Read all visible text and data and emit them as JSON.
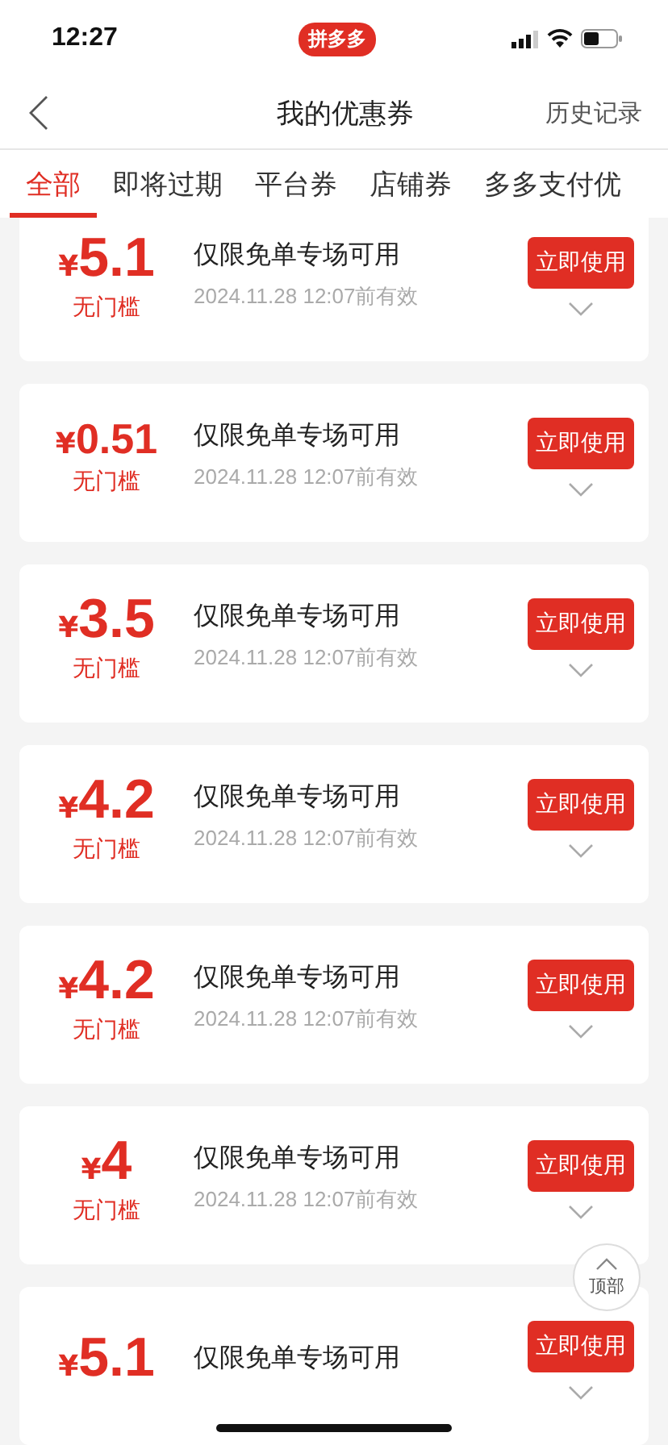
{
  "status_bar": {
    "time": "12:27",
    "app_badge": "拼多多"
  },
  "nav": {
    "title": "我的优惠券",
    "action": "历史记录"
  },
  "tabs": [
    {
      "label": "全部",
      "selected": true
    },
    {
      "label": "即将过期",
      "selected": false
    },
    {
      "label": "平台券",
      "selected": false
    },
    {
      "label": "店铺券",
      "selected": false
    },
    {
      "label": "多多支付优",
      "selected": false
    }
  ],
  "coupons": [
    {
      "currency": "¥",
      "amount": "5.1",
      "condition": "无门槛",
      "title": "仅限免单专场可用",
      "validity": "2024.11.28 12:07前有效",
      "button": "立即使用"
    },
    {
      "currency": "¥",
      "amount": "0.51",
      "condition": "无门槛",
      "title": "仅限免单专场可用",
      "validity": "2024.11.28 12:07前有效",
      "button": "立即使用"
    },
    {
      "currency": "¥",
      "amount": "3.5",
      "condition": "无门槛",
      "title": "仅限免单专场可用",
      "validity": "2024.11.28 12:07前有效",
      "button": "立即使用"
    },
    {
      "currency": "¥",
      "amount": "4.2",
      "condition": "无门槛",
      "title": "仅限免单专场可用",
      "validity": "2024.11.28 12:07前有效",
      "button": "立即使用"
    },
    {
      "currency": "¥",
      "amount": "4.2",
      "condition": "无门槛",
      "title": "仅限免单专场可用",
      "validity": "2024.11.28 12:07前有效",
      "button": "立即使用"
    },
    {
      "currency": "¥",
      "amount": "4",
      "condition": "无门槛",
      "title": "仅限免单专场可用",
      "validity": "2024.11.28 12:07前有效",
      "button": "立即使用"
    },
    {
      "currency": "¥",
      "amount": "5.1",
      "title": "仅限免单专场可用",
      "button": "立即使用"
    }
  ],
  "top_button": {
    "label": "顶部"
  }
}
